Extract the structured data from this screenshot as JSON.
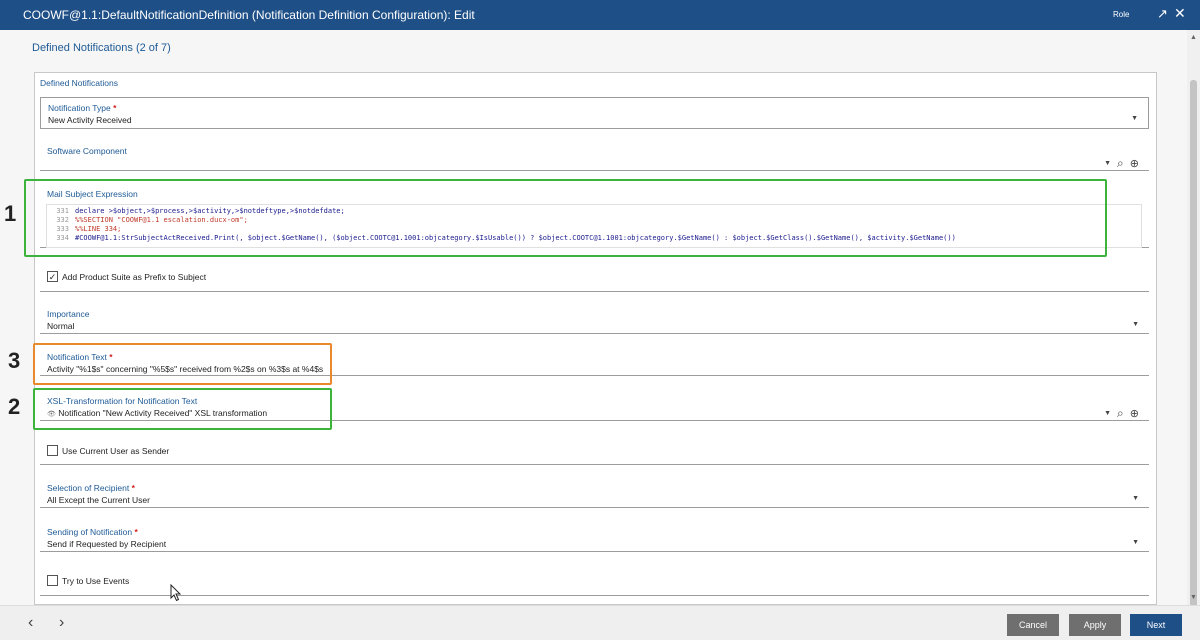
{
  "window": {
    "title": "COOWF@1.1:DefaultNotificationDefinition (Notification Definition Configuration): Edit",
    "role_label": "Role",
    "maximize_icon": "↗",
    "close_icon": "✕"
  },
  "page": {
    "title": "Defined Notifications (2 of 7)",
    "group_label": "Defined Notifications"
  },
  "fields": {
    "notification_type": {
      "label": "Notification Type",
      "required_mark": "*",
      "value": "New Activity Received"
    },
    "software_component": {
      "label": "Software Component",
      "value": ""
    },
    "mail_subject": {
      "label": "Mail Subject Expression",
      "lines": [
        {
          "num": "331",
          "text": "declare >$object,>$process,>$activity,>$notdeftype,>$notdefdate;"
        },
        {
          "num": "332",
          "text": "%%SECTION \"COOWF@1.1 escalation.ducx-om\";"
        },
        {
          "num": "333",
          "text": "%%LINE 334;"
        },
        {
          "num": "334",
          "text": "#COOWF@1.1:StrSubjectActReceived.Print(, $object.$GetName(), ($object.COOTC@1.1001:objcategory.$IsUsable()) ? $object.COOTC@1.1001:objcategory.$GetName() : $object.$GetClass().$GetName(), $activity.$GetName())"
        }
      ]
    },
    "add_product_suite": {
      "label": "Add Product Suite as Prefix to Subject",
      "checked": true,
      "check_mark": "✓"
    },
    "importance": {
      "label": "Importance",
      "value": "Normal"
    },
    "notification_text": {
      "label": "Notification Text",
      "required_mark": "*",
      "value": "Activity \"%1$s\" concerning \"%5$s\" received from %2$s on %3$s at %4$s"
    },
    "xsl_transformation": {
      "label": "XSL-Transformation for Notification Text",
      "value": "Notification \"New Activity Received\" XSL transformation",
      "icon": "👁"
    },
    "use_current_user": {
      "label": "Use Current User as Sender",
      "checked": false
    },
    "selection_of_recipient": {
      "label": "Selection of Recipient",
      "required_mark": "*",
      "value": "All Except the Current User"
    },
    "sending_of_notification": {
      "label": "Sending of Notification",
      "required_mark": "*",
      "value": "Send if Requested by Recipient"
    },
    "try_use_events": {
      "label": "Try to Use Events",
      "checked": false
    }
  },
  "icons": {
    "caret": "▼",
    "search": "⌕",
    "add": "⊕"
  },
  "annotations": [
    {
      "number": "1",
      "color": "#3cb43c"
    },
    {
      "number": "2",
      "color": "#3cb43c"
    },
    {
      "number": "3",
      "color": "#e8892b"
    }
  ],
  "footer": {
    "prev_icon": "‹",
    "next_icon": "›",
    "cancel_label": "Cancel",
    "apply_label": "Apply",
    "next_label": "Next"
  }
}
